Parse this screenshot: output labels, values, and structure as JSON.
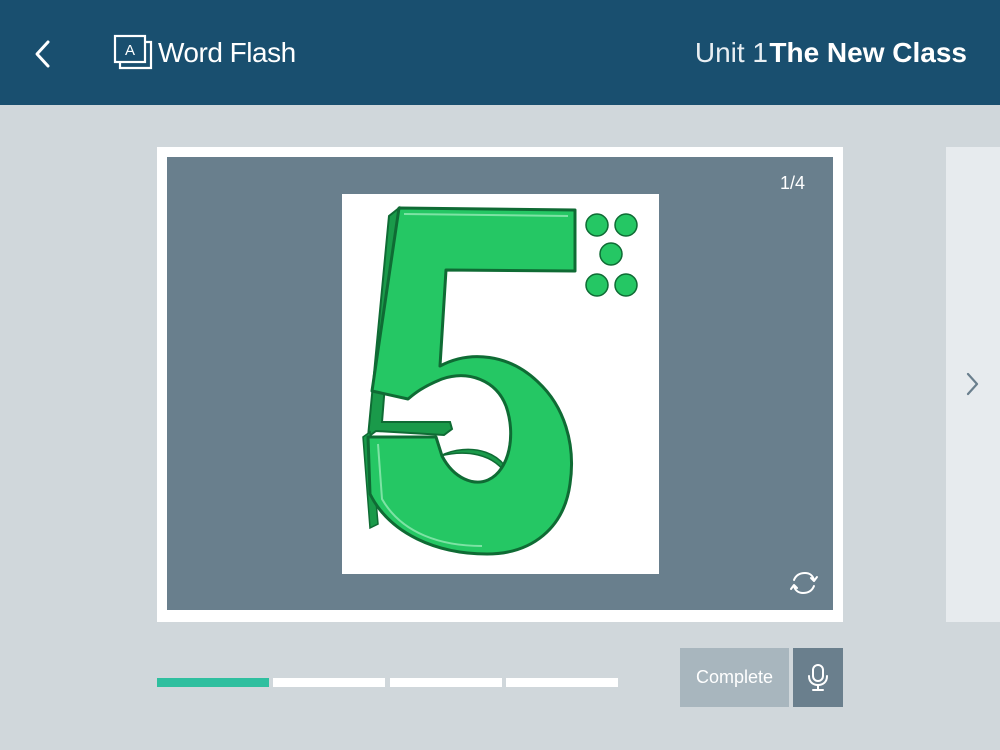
{
  "header": {
    "app_title": "Word Flash",
    "app_icon_letter": "A",
    "unit": "Unit 1",
    "lesson_title": "The New Class"
  },
  "card": {
    "page_counter": "1/4",
    "current_index": 1,
    "total": 4,
    "image_subject": "number five with five dots",
    "image_colors": {
      "digit": "#25c764",
      "digit_shade": "#1a9a4a",
      "outline": "#0f6b34"
    }
  },
  "progress": {
    "segments": 4,
    "completed": 1,
    "active_color": "#2fbf9f",
    "inactive_color": "#ffffff"
  },
  "actions": {
    "complete_label": "Complete",
    "mic_icon": "microphone-icon"
  },
  "icons": {
    "back": "chevron-left-icon",
    "next": "chevron-right-icon",
    "flip": "refresh-icon",
    "app": "flashcard-icon"
  },
  "colors": {
    "header_bg": "#194f6f",
    "page_bg": "#d0d7db",
    "card_bg": "#697f8d"
  }
}
